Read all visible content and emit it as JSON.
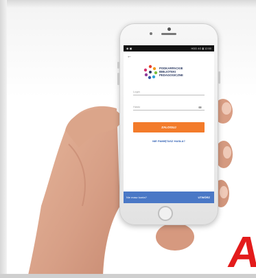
{
  "screen": {
    "status_bar": {
      "left": "◉ ▣",
      "right": "HDD 4G ▮ 12:50"
    },
    "back_label": "←",
    "org": {
      "lines": [
        "PODKARPACKIE",
        "BIBLIOTEKI",
        "PEDAGOGICZNE"
      ]
    },
    "login": {
      "login_placeholder": "Login",
      "password_placeholder": "Hasło",
      "submit_label": "ZALOGUJ",
      "forgot_label": "NIE PAMIĘTASZ HASŁA?"
    },
    "footer": {
      "no_account": "Nie masz konta?",
      "create_label": "UTWÓRZ"
    }
  },
  "decor": {
    "corner_letter": "A"
  },
  "colors": {
    "accent_orange": "#f37b2a",
    "accent_blue": "#4a78c6",
    "brand_navy": "#2b3a63",
    "link_blue": "#2f5fb3",
    "red": "#e31b1b"
  }
}
